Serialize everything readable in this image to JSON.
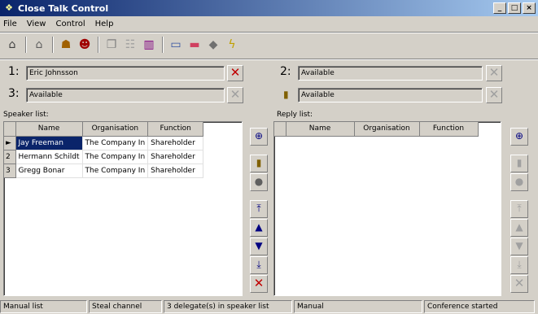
{
  "window": {
    "title": "Close Talk Control",
    "controls": [
      "_",
      "□",
      "×"
    ]
  },
  "menu": [
    "File",
    "View",
    "Control",
    "Help"
  ],
  "toolbar": [
    "door-icon",
    "home-icon",
    "people-icon",
    "person-icon",
    "copy-icon",
    "tree-icon",
    "chart-icon",
    "monitor-icon",
    "bar-icon",
    "megaphone-icon",
    "lightning-icon"
  ],
  "channels": [
    {
      "num": "1:",
      "value": "Eric Johnsson",
      "x": "✕"
    },
    {
      "num": "2:",
      "value": "Available",
      "x": "✕"
    },
    {
      "num": "3:",
      "value": "Available",
      "x": "✕"
    },
    {
      "num": "",
      "value": "Available",
      "x": "✕"
    }
  ],
  "speaker_list": {
    "label": "Speaker list:",
    "columns": [
      "Name",
      "Organisation",
      "Function"
    ],
    "rows": [
      {
        "ind": "►",
        "name": "Jay Freeman",
        "org": "The Company In",
        "func": "Shareholder"
      },
      {
        "ind": "2",
        "name": "Hermann Schildt",
        "org": "The Company In",
        "func": "Shareholder"
      },
      {
        "ind": "3",
        "name": "Gregg Bonar",
        "org": "The Company In",
        "func": "Shareholder"
      }
    ]
  },
  "reply_list": {
    "label": "Reply list:",
    "columns": [
      "Name",
      "Organisation",
      "Function"
    ]
  },
  "side_buttons": [
    "⊕",
    "▮",
    "●",
    "⤒",
    "▲",
    "▼",
    "⤓",
    "✕"
  ],
  "status": {
    "mode": "Manual list",
    "channel": "Steal channel",
    "delegates": "3 delegate(s) in speaker list",
    "reply": "Manual",
    "conference": "Conference started"
  },
  "colors": {
    "title_start": "#0a246a",
    "title_end": "#a6caf0",
    "selection": "#0a246a",
    "delete_red": "#c00000"
  }
}
